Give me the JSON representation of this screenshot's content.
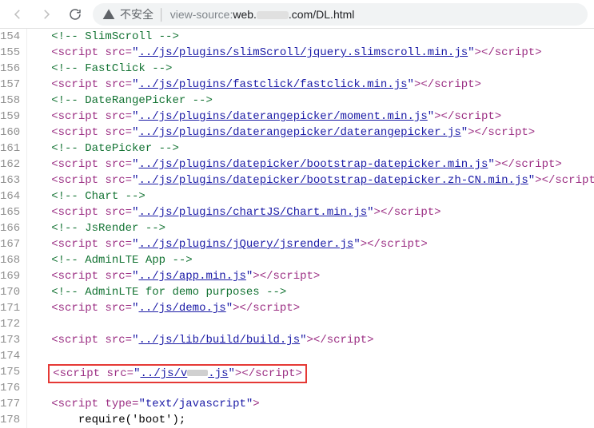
{
  "toolbar": {
    "warn_text": "不安全",
    "url_prefix": "view-source:",
    "url_host_pre": "web.",
    "url_host_post": ".com",
    "url_path": "/DL.html"
  },
  "lines": [
    {
      "n": 154,
      "kind": "cmt",
      "text": "<!-- SlimScroll -->"
    },
    {
      "n": 155,
      "kind": "script",
      "src": "../js/plugins/slimScroll/jquery.slimscroll.min.js"
    },
    {
      "n": 156,
      "kind": "cmt",
      "text": "<!-- FastClick -->"
    },
    {
      "n": 157,
      "kind": "script",
      "src": "../js/plugins/fastclick/fastclick.min.js"
    },
    {
      "n": 158,
      "kind": "cmt",
      "text": "<!-- DateRangePicker -->"
    },
    {
      "n": 159,
      "kind": "script",
      "src": "../js/plugins/daterangepicker/moment.min.js"
    },
    {
      "n": 160,
      "kind": "script",
      "src": "../js/plugins/daterangepicker/daterangepicker.js"
    },
    {
      "n": 161,
      "kind": "cmt",
      "text": "<!-- DatePicker -->"
    },
    {
      "n": 162,
      "kind": "script",
      "src": "../js/plugins/datepicker/bootstrap-datepicker.min.js"
    },
    {
      "n": 163,
      "kind": "script",
      "src": "../js/plugins/datepicker/bootstrap-datepicker.zh-CN.min.js"
    },
    {
      "n": 164,
      "kind": "cmt",
      "text": "<!-- Chart -->"
    },
    {
      "n": 165,
      "kind": "script",
      "src": "../js/plugins/chartJS/Chart.min.js"
    },
    {
      "n": 166,
      "kind": "cmt",
      "text": "<!-- JsRender -->"
    },
    {
      "n": 167,
      "kind": "script",
      "src": "../js/plugins/jQuery/jsrender.js"
    },
    {
      "n": 168,
      "kind": "cmt",
      "text": "<!-- AdminLTE App -->"
    },
    {
      "n": 169,
      "kind": "script",
      "src": "../js/app.min.js"
    },
    {
      "n": 170,
      "kind": "cmt",
      "text": "<!-- AdminLTE for demo purposes -->"
    },
    {
      "n": 171,
      "kind": "script",
      "src": "../js/demo.js"
    },
    {
      "n": 172,
      "kind": "blank"
    },
    {
      "n": 173,
      "kind": "script",
      "src": "../js/lib/build/build.js"
    },
    {
      "n": 174,
      "kind": "blank"
    },
    {
      "n": 175,
      "kind": "script-redact",
      "src_pre": "../js/v",
      "src_post": ".js",
      "highlight": true
    },
    {
      "n": 176,
      "kind": "blank"
    },
    {
      "n": 177,
      "kind": "script-open",
      "type": "text/javascript"
    },
    {
      "n": 178,
      "kind": "js",
      "text": "    require('boot');"
    }
  ],
  "t": {
    "lt": "<",
    "gt": ">",
    "slash": "/",
    "script": "script",
    "src": "src",
    "type": "type",
    "eq": "=",
    "q": "\""
  }
}
